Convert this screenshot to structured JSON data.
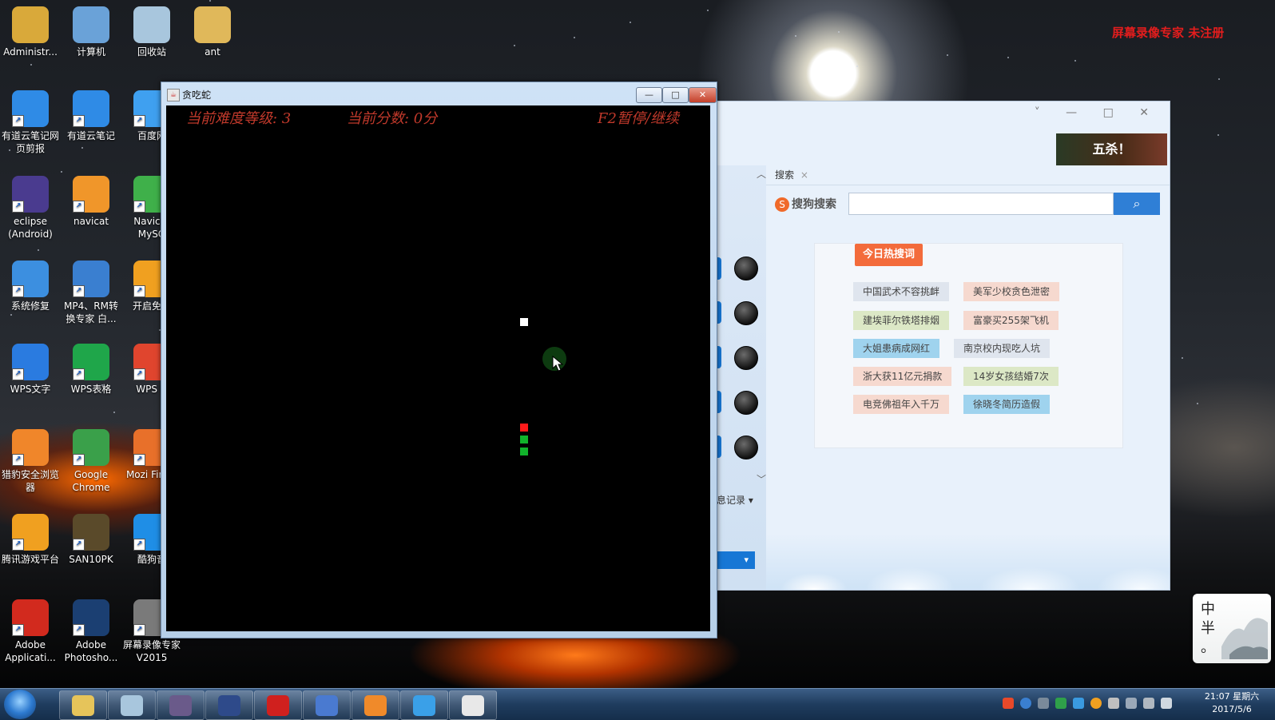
{
  "watermark": "屏幕录像专家  未注册",
  "desktop_icons": [
    {
      "label": "Administr...",
      "icon": "user-folder-icon",
      "color": "#d9a93a"
    },
    {
      "label": "计算机",
      "icon": "computer-icon",
      "color": "#6aa2d8"
    },
    {
      "label": "回收站",
      "icon": "recycle-bin-icon",
      "color": "#a8c6dd"
    },
    {
      "label": "ant",
      "icon": "folder-icon",
      "color": "#e0b85a"
    },
    {
      "label": "有道云笔记网页剪报",
      "icon": "youdao-clip-icon",
      "color": "#2f8be6"
    },
    {
      "label": "有道云笔记",
      "icon": "youdao-note-icon",
      "color": "#2f8be6"
    },
    {
      "label": "百度网",
      "icon": "baidu-netdisk-icon",
      "color": "#3fa0f0"
    },
    {
      "label": "eclipse (Android)",
      "icon": "eclipse-icon",
      "color": "#4a3b8f"
    },
    {
      "label": "navicat",
      "icon": "navicat-icon",
      "color": "#f0962a"
    },
    {
      "label": "Navicat MySQ",
      "icon": "navicat-mysql-icon",
      "color": "#3fb04a"
    },
    {
      "label": "系统修复",
      "icon": "system-repair-icon",
      "color": "#3c8fe0"
    },
    {
      "label": "MP4、RM转换专家 白...",
      "icon": "converter-icon",
      "color": "#3a7fd0"
    },
    {
      "label": "开启免费",
      "icon": "wifi-icon",
      "color": "#f0a020"
    },
    {
      "label": "WPS文字",
      "icon": "wps-writer-icon",
      "color": "#2a7be0"
    },
    {
      "label": "WPS表格",
      "icon": "wps-sheet-icon",
      "color": "#1fa64a"
    },
    {
      "label": "WPS H",
      "icon": "wps-present-icon",
      "color": "#e0452e"
    },
    {
      "label": "猎豹安全浏览器",
      "icon": "liebao-browser-icon",
      "color": "#f0862a"
    },
    {
      "label": "Google Chrome",
      "icon": "chrome-icon",
      "color": "#3aa04a"
    },
    {
      "label": "Mozi Firefo",
      "icon": "firefox-icon",
      "color": "#e8702a"
    },
    {
      "label": "腾讯游戏平台",
      "icon": "tencent-games-icon",
      "color": "#f0a020"
    },
    {
      "label": "SAN10PK",
      "icon": "san10pk-icon",
      "color": "#5a4a2a"
    },
    {
      "label": "酷狗音",
      "icon": "kugou-icon",
      "color": "#1f8ee6"
    },
    {
      "label": "Adobe Applicati...",
      "icon": "adobe-icon",
      "color": "#d22a1e"
    },
    {
      "label": "Adobe Photosho...",
      "icon": "photoshop-icon",
      "color": "#1b3f72"
    },
    {
      "label": "屏幕录像专家 V2015",
      "icon": "screen-recorder-icon",
      "color": "#7a7a7a"
    }
  ],
  "snake_window": {
    "title": "贪吃蛇",
    "minimize": "—",
    "maximize": "□",
    "close": "✕",
    "hud_level": "当前难度等级: 3",
    "hud_score": "当前分数: 0分",
    "hud_pause": "F2暂停/继续",
    "food_color": "#ffffff",
    "head_color": "#ff1a1a",
    "body_color": "#11b32b"
  },
  "qq_panel": {
    "ad_text": "五杀！",
    "controls": "˅ — □ ✕",
    "search_tab_label": "搜索",
    "search_tab_close": "×",
    "sogou_label": "搜狗搜索",
    "sogou_mark": "S",
    "search_button": "⌕",
    "hot_title": "今日热搜词",
    "hot_tags": [
      {
        "text": "中国武术不容挑衅",
        "bg": "#dfe5ee"
      },
      {
        "text": "美军少校贪色泄密",
        "bg": "#f6d9cf"
      },
      {
        "text": "建埃菲尔铁塔排烟",
        "bg": "#dce8c6"
      },
      {
        "text": "富豪买255架飞机",
        "bg": "#f6d9cf"
      },
      {
        "text": "大姐患病成网红",
        "bg": "#9fd3ee"
      },
      {
        "text": "南京校内现吃人坑",
        "bg": "#dfe5ee"
      },
      {
        "text": "浙大获11亿元捐款",
        "bg": "#f6d9cf"
      },
      {
        "text": "14岁女孩结婚7次",
        "bg": "#dce8c6"
      },
      {
        "text": "电竞佛祖年入千万",
        "bg": "#f6d9cf"
      },
      {
        "text": "徐晓冬简历造假",
        "bg": "#9fd3ee"
      }
    ],
    "chat_record": "息记录 ▾",
    "send_label": "▾"
  },
  "ink_widget": {
    "text": "中 半 。"
  },
  "taskbar": {
    "apps": [
      {
        "icon": "explorer-icon",
        "color": "#e6c45a"
      },
      {
        "icon": "notepad-icon",
        "color": "#a8c6dd"
      },
      {
        "icon": "java-decompiler-icon",
        "color": "#6a5a8a"
      },
      {
        "icon": "eclipse-taskbar-icon",
        "color": "#2e4a8a"
      },
      {
        "icon": "app-red-icon",
        "color": "#d0201e"
      },
      {
        "icon": "dolphin-icon",
        "color": "#4a7ad0"
      },
      {
        "icon": "liebao-taskbar-icon",
        "color": "#f08a2a"
      },
      {
        "icon": "qq-browser-icon",
        "color": "#3aa0e8"
      },
      {
        "icon": "java-icon",
        "color": "#e8e8e8"
      }
    ],
    "clock_time": "21:07 星期六",
    "clock_date": "2017/5/6"
  }
}
